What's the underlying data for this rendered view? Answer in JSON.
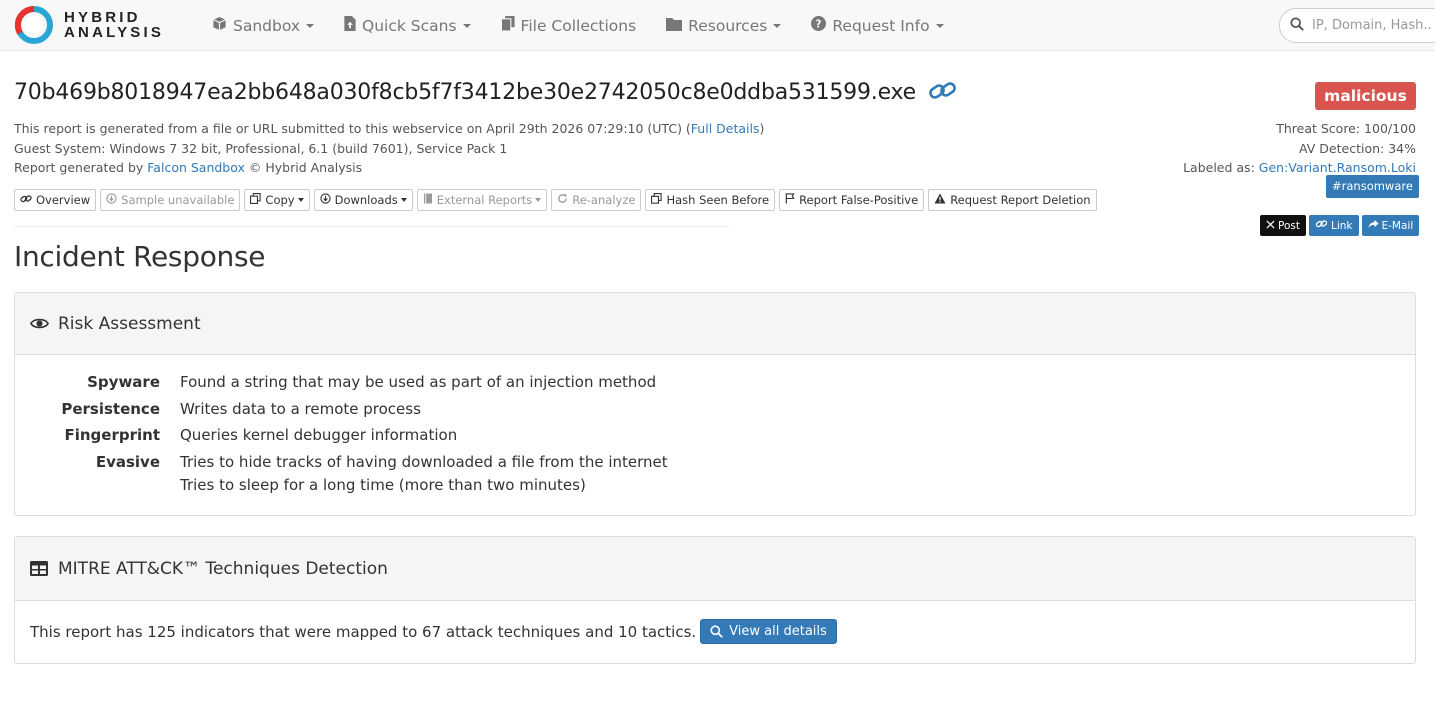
{
  "brand": {
    "line1": "HYBRID",
    "line2": "ANALYSIS"
  },
  "nav": [
    {
      "label": "Sandbox",
      "icon": "cube-icon",
      "dropdown": true
    },
    {
      "label": "Quick Scans",
      "icon": "file-upload-icon",
      "dropdown": true
    },
    {
      "label": "File Collections",
      "icon": "files-icon",
      "dropdown": false
    },
    {
      "label": "Resources",
      "icon": "folder-icon",
      "dropdown": true
    },
    {
      "label": "Request Info",
      "icon": "question-circle-icon",
      "dropdown": true
    }
  ],
  "search": {
    "placeholder": "IP, Domain, Hash..."
  },
  "report": {
    "title": "70b469b8018947ea2bb648a030f8cb5f7f3412be30e2742050c8e0ddba531599.exe",
    "verdict": "malicious",
    "meta_line1_prefix": "This report is generated from a file or URL submitted to this webservice on April 29th 2026 07:29:10 (UTC) (",
    "meta_line1_link": "Full Details",
    "meta_line1_suffix": ")",
    "guest_system": "Guest System: Windows 7 32 bit, Professional, 6.1 (build 7601), Service Pack 1",
    "generated_prefix": "Report generated by ",
    "generated_link": "Falcon Sandbox",
    "generated_suffix": " © Hybrid Analysis",
    "threat_score": "Threat Score: 100/100",
    "av_detection": "AV Detection: 34%",
    "labeled_prefix": "Labeled as: ",
    "labeled_link": "Gen:Variant.Ransom.Loki",
    "tag": "#ransomware"
  },
  "toolbar": {
    "overview": "Overview",
    "sample_unavailable": "Sample unavailable",
    "copy": "Copy",
    "downloads": "Downloads",
    "external_reports": "External Reports",
    "reanalyze": "Re-analyze",
    "hash_seen_before": "Hash Seen Before",
    "report_false_positive": "Report False-Positive",
    "request_deletion": "Request Report Deletion"
  },
  "share": {
    "post": "Post",
    "link": "Link",
    "email": "E-Mail"
  },
  "section_title": "Incident Response",
  "risk_panel": {
    "title": "Risk Assessment",
    "rows": [
      {
        "label": "Spyware",
        "values": [
          "Found a string that may be used as part of an injection method"
        ]
      },
      {
        "label": "Persistence",
        "values": [
          "Writes data to a remote process"
        ]
      },
      {
        "label": "Fingerprint",
        "values": [
          "Queries kernel debugger information"
        ]
      },
      {
        "label": "Evasive",
        "values": [
          "Tries to hide tracks of having downloaded a file from the internet",
          "Tries to sleep for a long time (more than two minutes)"
        ]
      }
    ]
  },
  "mitre_panel": {
    "title": "MITRE ATT&CK™ Techniques Detection",
    "text": "This report has 125 indicators that were mapped to 67 attack techniques and 10 tactics.",
    "button": "View all details"
  },
  "colors": {
    "malicious": "#d9534f",
    "link": "#337ab7",
    "brand_red": "#e8322d",
    "brand_blue": "#2aa6d6"
  }
}
